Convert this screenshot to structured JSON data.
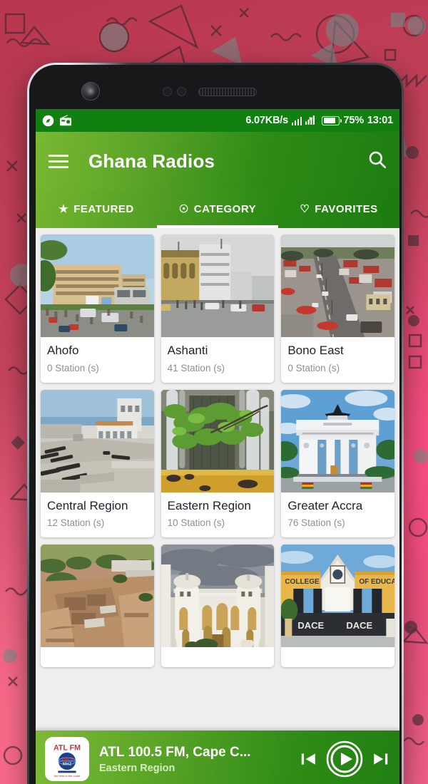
{
  "status_bar": {
    "network_speed": "6.07KB/s",
    "battery_percent": "75%",
    "time": "13:01",
    "left_icons": [
      "compass-icon",
      "radio-icon"
    ],
    "right_icons": [
      "signal-bars-icon",
      "wifi-signal-icon",
      "battery-icon"
    ]
  },
  "appbar": {
    "title": "Ghana Radios",
    "menu_icon": "hamburger-menu-icon",
    "search_icon": "search-icon"
  },
  "tabs": [
    {
      "label": "FEATURED",
      "icon": "star-icon",
      "glyph": "★",
      "selected": false
    },
    {
      "label": "CATEGORY",
      "icon": "target-circle-icon",
      "glyph": "☉",
      "selected": true
    },
    {
      "label": "FAVORITES",
      "icon": "heart-outline-icon",
      "glyph": "♡",
      "selected": false
    }
  ],
  "categories": [
    {
      "title": "Ahofo",
      "stations": "0 Station (s)",
      "image": "accra-street-buildings"
    },
    {
      "title": "Ashanti",
      "stations": "41 Station (s)",
      "image": "kumasi-street-scene"
    },
    {
      "title": "Bono East",
      "stations": "0 Station (s)",
      "image": "aerial-market-road"
    },
    {
      "title": "Central Region",
      "stations": "12 Station (s)",
      "image": "cape-coast-castle-cannons"
    },
    {
      "title": "Eastern Region",
      "stations": "10 Station (s)",
      "image": "boti-waterfalls"
    },
    {
      "title": "Greater Accra",
      "stations": "76 Station (s)",
      "image": "independence-black-star-arch"
    },
    {
      "title": "",
      "stations": "",
      "image": "ruins-archaeological-site"
    },
    {
      "title": "",
      "stations": "",
      "image": "white-domed-palace"
    },
    {
      "title": "",
      "stations": "",
      "image": "college-of-education-gate"
    }
  ],
  "player": {
    "station_name": "ATL 100.5 FM, Cape C...",
    "station_region": "Eastern Region",
    "logo_top_text": "ATL FM",
    "logo_mid_text": "100.5 MHZ",
    "logo_bottom_text": "the best of the coast",
    "prev_icon": "skip-previous-icon",
    "play_icon": "play-icon",
    "next_icon": "skip-next-icon"
  },
  "colors": {
    "brand_green_dark": "#1d7d10",
    "brand_green_light": "#79b832",
    "status_bar_green": "#118011",
    "background_pink": "#c0405a",
    "card_bg": "#ffffff",
    "content_bg": "#efefef"
  }
}
